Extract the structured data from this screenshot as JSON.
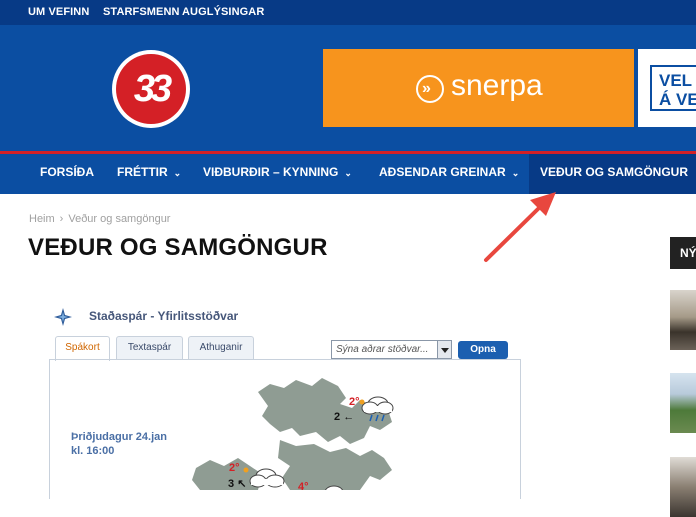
{
  "topbar": {
    "items": [
      "UM VEFINN",
      "STARFSMENN",
      "AUGLÝSINGAR"
    ]
  },
  "header": {
    "logo_text": "33",
    "ad_main_text": "snerpa",
    "ad_main_mark": "»",
    "ad_right_lines": [
      "VEL",
      "Á VE"
    ]
  },
  "nav": {
    "items": [
      {
        "label": "FORSÍÐA",
        "dropdown": false
      },
      {
        "label": "FRÉTTIR",
        "dropdown": true
      },
      {
        "label": "VIÐBURÐIR – KYNNING",
        "dropdown": true
      },
      {
        "label": "AÐSENDAR GREINAR",
        "dropdown": true
      },
      {
        "label": "VEÐUR OG SAMGÖNGUR",
        "dropdown": false,
        "active": true
      }
    ],
    "caret": "⌄"
  },
  "breadcrumb": {
    "home": "Heim",
    "separator": "›",
    "current": "Veður og samgöngur"
  },
  "page": {
    "title": "VEÐUR OG SAMGÖNGUR"
  },
  "sidebar": {
    "header": "NÝ"
  },
  "widget": {
    "title": "Staðaspár - Yfirlitsstöðvar",
    "tabs": [
      "Spákort",
      "Textaspár",
      "Athuganir"
    ],
    "active_tab": "Spákort",
    "select_placeholder": "Sýna aðrar stöðvar...",
    "button": "Opna",
    "date_line1": "Þriðjudagur 24.jan",
    "date_line2": "kl. 16:00",
    "stations": [
      {
        "temp": "2°",
        "wind": "2",
        "wind_dir": "←"
      },
      {
        "temp": "2°",
        "wind": "3",
        "wind_dir": "↖"
      },
      {
        "temp": "4°"
      }
    ]
  },
  "colors": {
    "topbar": "#073a86",
    "header": "#0b4ea2",
    "accent_red": "#d42026",
    "ad_orange": "#f7941d",
    "arrow": "#e8473e"
  }
}
